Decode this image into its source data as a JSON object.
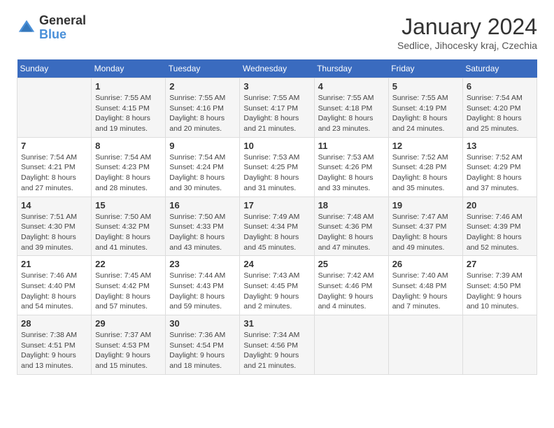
{
  "logo": {
    "general": "General",
    "blue": "Blue"
  },
  "header": {
    "title": "January 2024",
    "subtitle": "Sedlice, Jihocesky kraj, Czechia"
  },
  "weekdays": [
    "Sunday",
    "Monday",
    "Tuesday",
    "Wednesday",
    "Thursday",
    "Friday",
    "Saturday"
  ],
  "weeks": [
    [
      {
        "day": "",
        "info": ""
      },
      {
        "day": "1",
        "info": "Sunrise: 7:55 AM\nSunset: 4:15 PM\nDaylight: 8 hours\nand 19 minutes."
      },
      {
        "day": "2",
        "info": "Sunrise: 7:55 AM\nSunset: 4:16 PM\nDaylight: 8 hours\nand 20 minutes."
      },
      {
        "day": "3",
        "info": "Sunrise: 7:55 AM\nSunset: 4:17 PM\nDaylight: 8 hours\nand 21 minutes."
      },
      {
        "day": "4",
        "info": "Sunrise: 7:55 AM\nSunset: 4:18 PM\nDaylight: 8 hours\nand 23 minutes."
      },
      {
        "day": "5",
        "info": "Sunrise: 7:55 AM\nSunset: 4:19 PM\nDaylight: 8 hours\nand 24 minutes."
      },
      {
        "day": "6",
        "info": "Sunrise: 7:54 AM\nSunset: 4:20 PM\nDaylight: 8 hours\nand 25 minutes."
      }
    ],
    [
      {
        "day": "7",
        "info": "Sunrise: 7:54 AM\nSunset: 4:21 PM\nDaylight: 8 hours\nand 27 minutes."
      },
      {
        "day": "8",
        "info": "Sunrise: 7:54 AM\nSunset: 4:23 PM\nDaylight: 8 hours\nand 28 minutes."
      },
      {
        "day": "9",
        "info": "Sunrise: 7:54 AM\nSunset: 4:24 PM\nDaylight: 8 hours\nand 30 minutes."
      },
      {
        "day": "10",
        "info": "Sunrise: 7:53 AM\nSunset: 4:25 PM\nDaylight: 8 hours\nand 31 minutes."
      },
      {
        "day": "11",
        "info": "Sunrise: 7:53 AM\nSunset: 4:26 PM\nDaylight: 8 hours\nand 33 minutes."
      },
      {
        "day": "12",
        "info": "Sunrise: 7:52 AM\nSunset: 4:28 PM\nDaylight: 8 hours\nand 35 minutes."
      },
      {
        "day": "13",
        "info": "Sunrise: 7:52 AM\nSunset: 4:29 PM\nDaylight: 8 hours\nand 37 minutes."
      }
    ],
    [
      {
        "day": "14",
        "info": "Sunrise: 7:51 AM\nSunset: 4:30 PM\nDaylight: 8 hours\nand 39 minutes."
      },
      {
        "day": "15",
        "info": "Sunrise: 7:50 AM\nSunset: 4:32 PM\nDaylight: 8 hours\nand 41 minutes."
      },
      {
        "day": "16",
        "info": "Sunrise: 7:50 AM\nSunset: 4:33 PM\nDaylight: 8 hours\nand 43 minutes."
      },
      {
        "day": "17",
        "info": "Sunrise: 7:49 AM\nSunset: 4:34 PM\nDaylight: 8 hours\nand 45 minutes."
      },
      {
        "day": "18",
        "info": "Sunrise: 7:48 AM\nSunset: 4:36 PM\nDaylight: 8 hours\nand 47 minutes."
      },
      {
        "day": "19",
        "info": "Sunrise: 7:47 AM\nSunset: 4:37 PM\nDaylight: 8 hours\nand 49 minutes."
      },
      {
        "day": "20",
        "info": "Sunrise: 7:46 AM\nSunset: 4:39 PM\nDaylight: 8 hours\nand 52 minutes."
      }
    ],
    [
      {
        "day": "21",
        "info": "Sunrise: 7:46 AM\nSunset: 4:40 PM\nDaylight: 8 hours\nand 54 minutes."
      },
      {
        "day": "22",
        "info": "Sunrise: 7:45 AM\nSunset: 4:42 PM\nDaylight: 8 hours\nand 57 minutes."
      },
      {
        "day": "23",
        "info": "Sunrise: 7:44 AM\nSunset: 4:43 PM\nDaylight: 8 hours\nand 59 minutes."
      },
      {
        "day": "24",
        "info": "Sunrise: 7:43 AM\nSunset: 4:45 PM\nDaylight: 9 hours\nand 2 minutes."
      },
      {
        "day": "25",
        "info": "Sunrise: 7:42 AM\nSunset: 4:46 PM\nDaylight: 9 hours\nand 4 minutes."
      },
      {
        "day": "26",
        "info": "Sunrise: 7:40 AM\nSunset: 4:48 PM\nDaylight: 9 hours\nand 7 minutes."
      },
      {
        "day": "27",
        "info": "Sunrise: 7:39 AM\nSunset: 4:50 PM\nDaylight: 9 hours\nand 10 minutes."
      }
    ],
    [
      {
        "day": "28",
        "info": "Sunrise: 7:38 AM\nSunset: 4:51 PM\nDaylight: 9 hours\nand 13 minutes."
      },
      {
        "day": "29",
        "info": "Sunrise: 7:37 AM\nSunset: 4:53 PM\nDaylight: 9 hours\nand 15 minutes."
      },
      {
        "day": "30",
        "info": "Sunrise: 7:36 AM\nSunset: 4:54 PM\nDaylight: 9 hours\nand 18 minutes."
      },
      {
        "day": "31",
        "info": "Sunrise: 7:34 AM\nSunset: 4:56 PM\nDaylight: 9 hours\nand 21 minutes."
      },
      {
        "day": "",
        "info": ""
      },
      {
        "day": "",
        "info": ""
      },
      {
        "day": "",
        "info": ""
      }
    ]
  ]
}
